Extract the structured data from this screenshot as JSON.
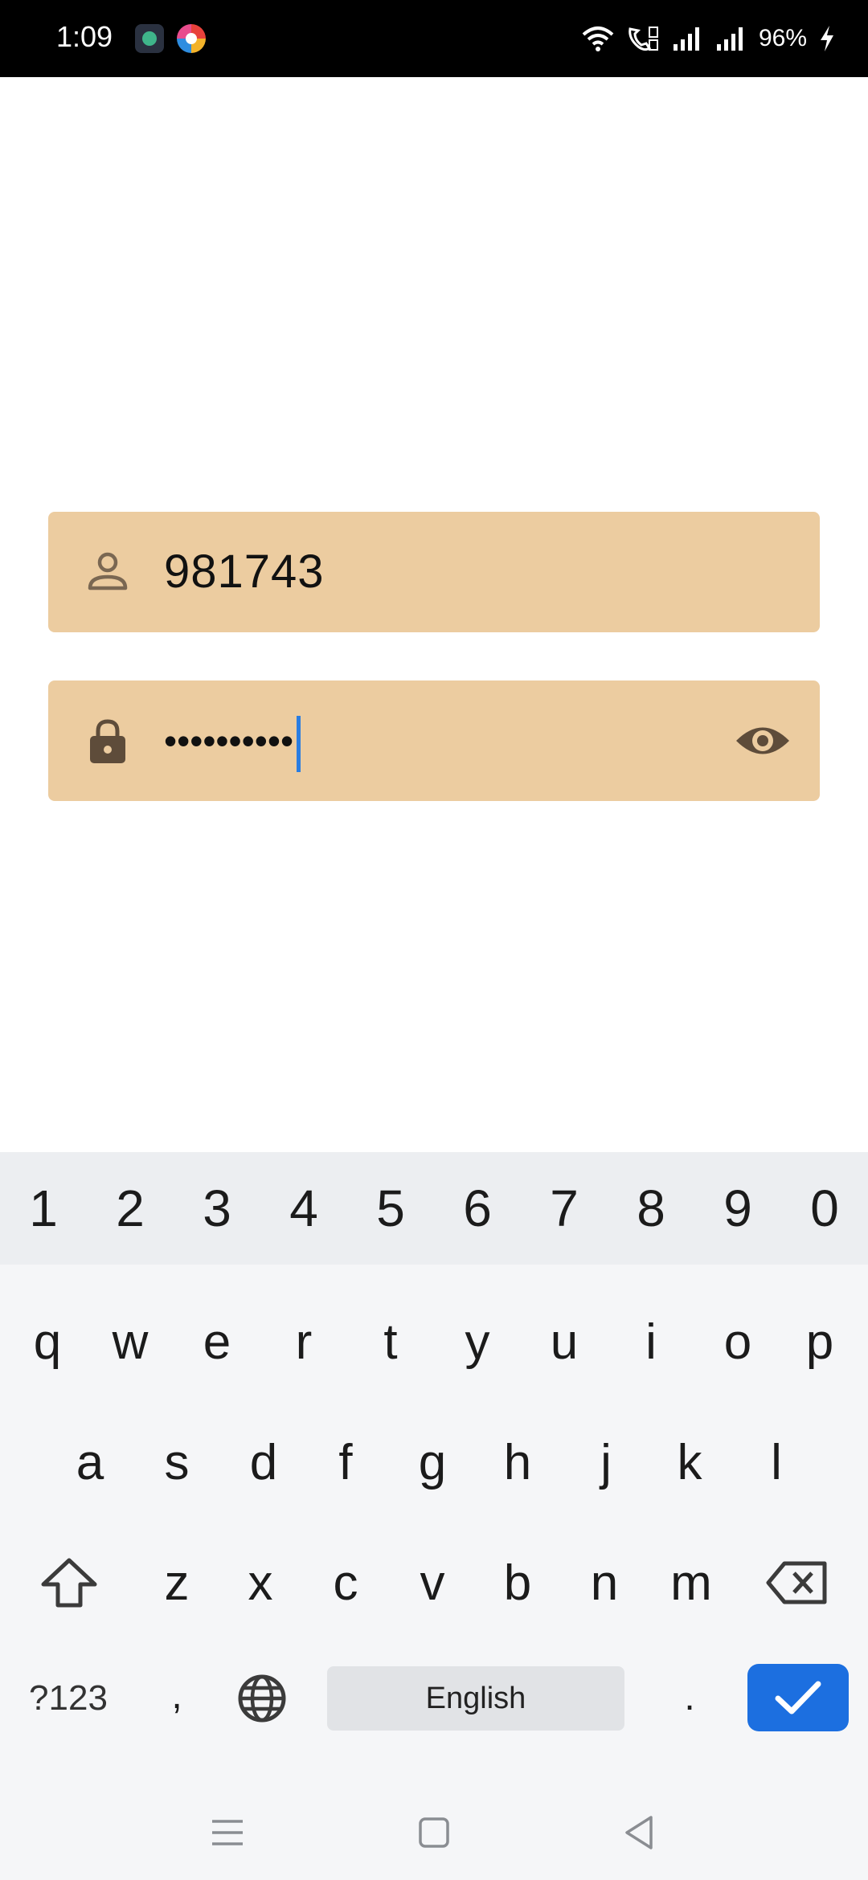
{
  "status_bar": {
    "time": "1:09",
    "battery_text": "96%",
    "icons": [
      "app-icon-1",
      "app-icon-2",
      "wifi-icon",
      "call-icon",
      "signal-icon",
      "signal-icon-2",
      "charging-icon"
    ]
  },
  "form": {
    "username_value": "981743",
    "password_value": "••••••••••"
  },
  "keyboard": {
    "number_row": [
      "1",
      "2",
      "3",
      "4",
      "5",
      "6",
      "7",
      "8",
      "9",
      "0"
    ],
    "row1": [
      "q",
      "w",
      "e",
      "r",
      "t",
      "y",
      "u",
      "i",
      "o",
      "p"
    ],
    "row2": [
      "a",
      "s",
      "d",
      "f",
      "g",
      "h",
      "j",
      "k",
      "l"
    ],
    "row3": [
      "z",
      "x",
      "c",
      "v",
      "b",
      "n",
      "m"
    ],
    "symbols_label": "?123",
    "comma_label": ",",
    "space_label": "English",
    "period_label": "."
  },
  "colors": {
    "field_bg": "#eccca0",
    "icon_color": "#6b5a47",
    "enter_bg": "#1c6fe0",
    "caret": "#2a7de1"
  }
}
